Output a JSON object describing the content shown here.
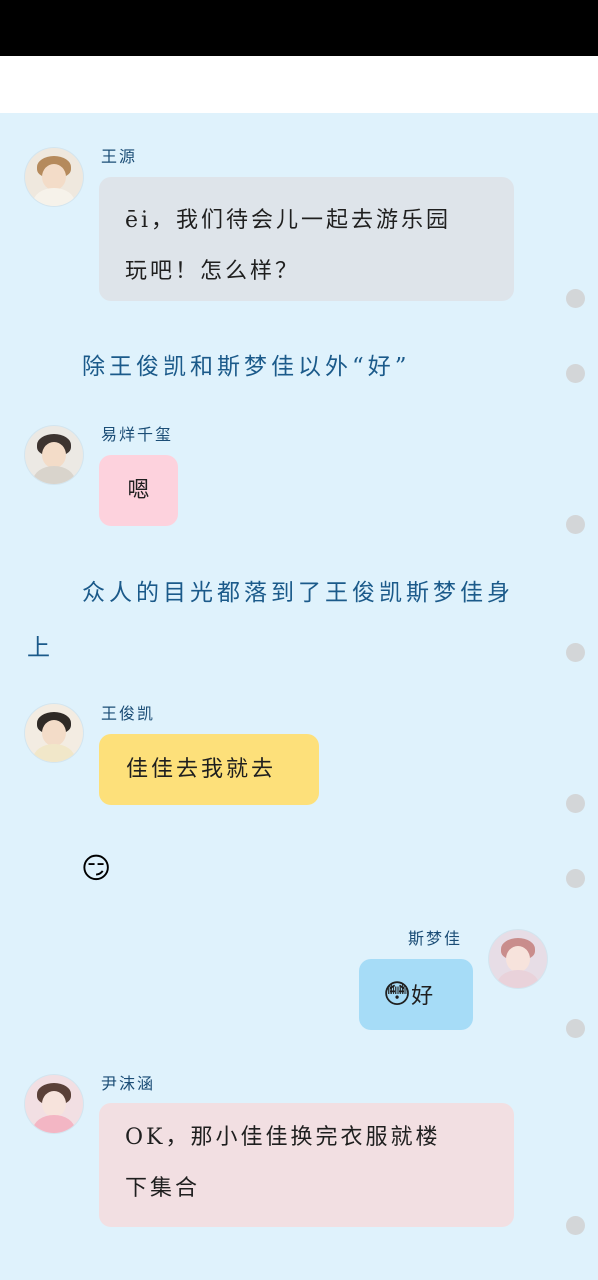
{
  "messages": [
    {
      "id": "m1",
      "sender": "王源",
      "text_line1": "ēi，我们待会儿一起去游乐园",
      "text_line2": "玩吧！怎么样？"
    },
    {
      "id": "n1",
      "narration": "除王俊凯和斯梦佳以外“好”"
    },
    {
      "id": "m2",
      "sender": "易烊千玺",
      "text": "嗯"
    },
    {
      "id": "n2",
      "narration_line1": "众人的目光都落到了王俊凯斯梦佳身",
      "narration_line2": "上"
    },
    {
      "id": "m3",
      "sender": "王俊凯",
      "text": "佳佳去我就去"
    },
    {
      "id": "m4",
      "emoji": "😏"
    },
    {
      "id": "m5",
      "sender": "斯梦佳",
      "emoji": "😳",
      "text": "好"
    },
    {
      "id": "m6",
      "sender": "尹沫涵",
      "text_line1": "OK，那小佳佳换完衣服就楼",
      "text_line2": "下集合"
    }
  ],
  "colors": {
    "chat_background": "#dff2fc",
    "bubble_wangyuan": "#dee4ea",
    "bubble_yiyang": "#fdd2dd",
    "bubble_wangjunkai": "#fde07a",
    "bubble_simengjia": "#a6dcf7",
    "bubble_yinmohan": "#f2dfe2",
    "narration": "#1b5a8a"
  }
}
